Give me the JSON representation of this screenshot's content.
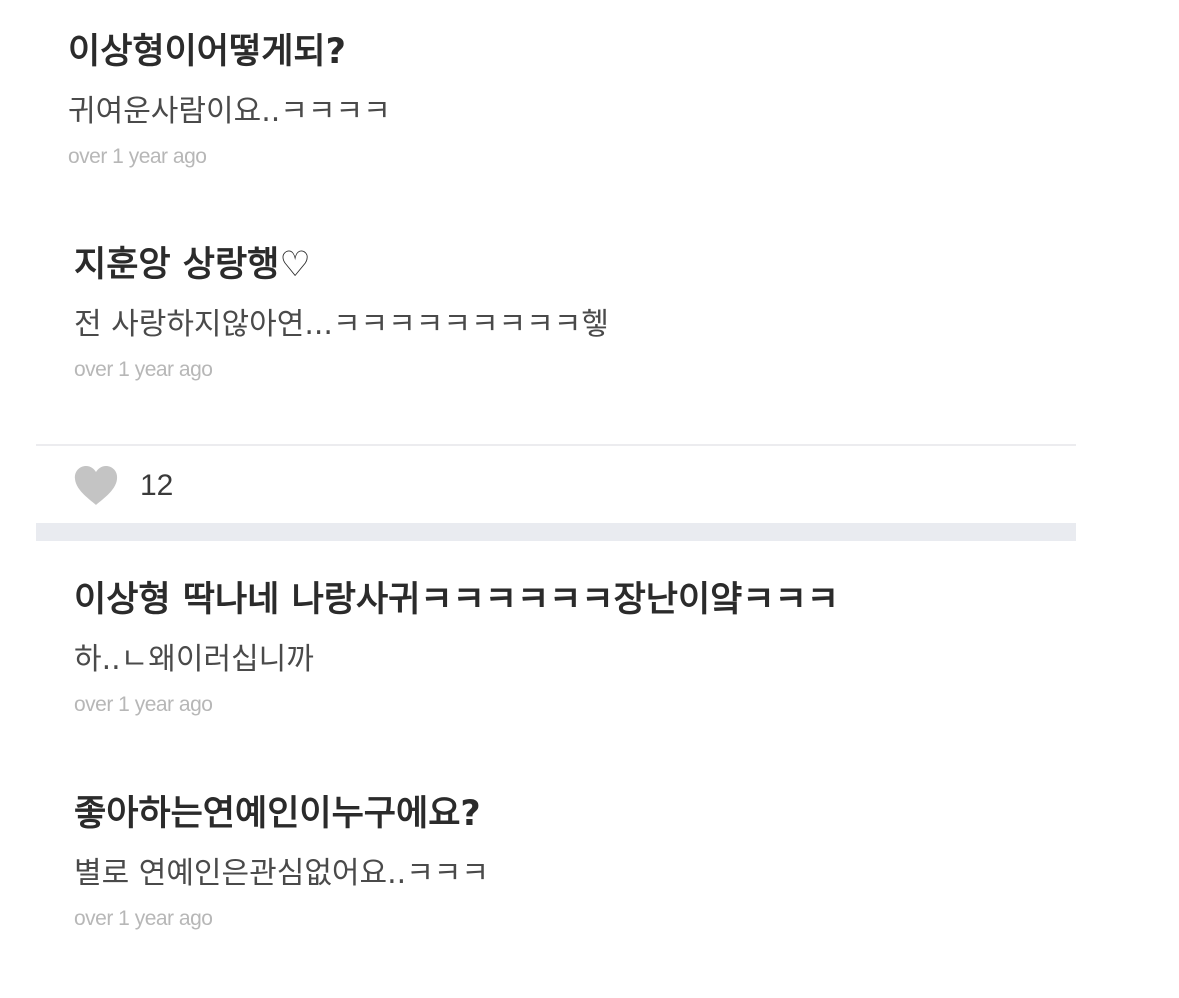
{
  "feed": {
    "top_items": [
      {
        "question": "이상형이어떻게되?",
        "answer": "귀여운사람이요..ㅋㅋㅋㅋ",
        "time": "over 1 year ago"
      },
      {
        "question": "지훈앙 상랑행♡",
        "answer": "전 사랑하지않아연...ㅋㅋㅋㅋㅋㅋㅋㅋㅋ헿",
        "time": "over 1 year ago"
      }
    ],
    "likes": {
      "count": "12",
      "icon": "heart-icon",
      "color": "#c4c4c4"
    },
    "bottom_items": [
      {
        "question": "이상형 딱나네 나랑사귀ㅋㅋㅋㅋㅋㅋ장난이얔ㅋㅋㅋ",
        "answer": "하..ㄴ왜이러십니까",
        "time": "over 1 year ago"
      },
      {
        "question": "좋아하는연예인이누구에요?",
        "answer": "별로 연예인은관심없어요..ㅋㅋㅋ",
        "time": "over 1 year ago"
      }
    ]
  }
}
